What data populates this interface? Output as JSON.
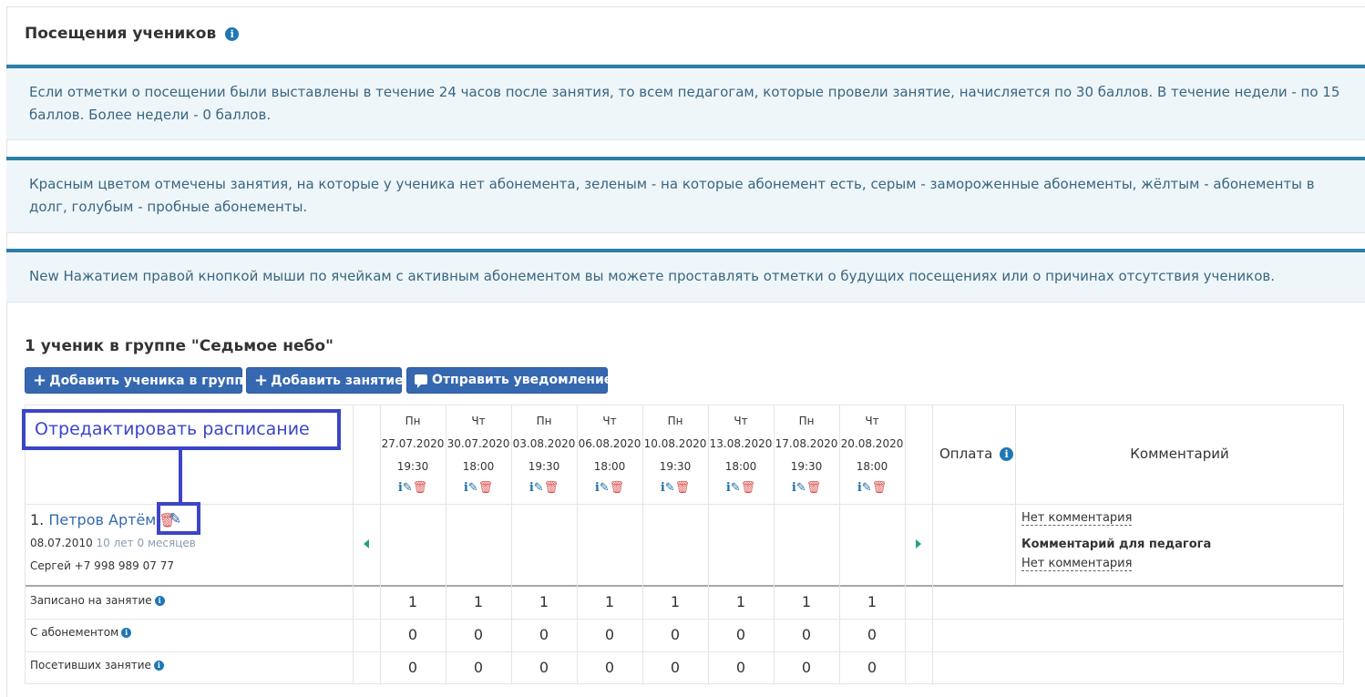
{
  "header": {
    "title": "Посещения учеников",
    "info_icon": "info-icon"
  },
  "alerts": [
    "Если отметки о посещении были выставлены в течение 24 часов после занятия, то всем педагогам, которые провели занятие, начисляется по 30 баллов. В течение недели - по 15 баллов. Более недели - 0 баллов.",
    "Красным цветом отмечены занятия, на которые у ученика нет абонемента, зеленым - на которые абонемент есть, серым - замороженные абонементы, жёлтым - абонементы в долг, голубым - пробные абонементы.",
    "New Нажатием правой кнопкой мыши по ячейкам с активным абонементом вы можете проставлять отметки о будущих посещениях или о причинах отсутствия учеников."
  ],
  "group": {
    "title": "1 ученик в группе \"Седьмое небо\"",
    "buttons": {
      "add_student": "Добавить ученика в группу",
      "add_lesson": "Добавить занятие",
      "send_notification": "Отправить уведомление"
    }
  },
  "annotation": {
    "text": "Отредактировать расписание",
    "color": "#3b45c8"
  },
  "lessons": [
    {
      "day": "Пн",
      "date": "27.07.2020",
      "time": "19:30"
    },
    {
      "day": "Чт",
      "date": "30.07.2020",
      "time": "18:00"
    },
    {
      "day": "Пн",
      "date": "03.08.2020",
      "time": "19:30"
    },
    {
      "day": "Чт",
      "date": "06.08.2020",
      "time": "18:00"
    },
    {
      "day": "Пн",
      "date": "10.08.2020",
      "time": "19:30"
    },
    {
      "day": "Чт",
      "date": "13.08.2020",
      "time": "18:00"
    },
    {
      "day": "Пн",
      "date": "17.08.2020",
      "time": "19:30"
    },
    {
      "day": "Чт",
      "date": "20.08.2020",
      "time": "18:00"
    }
  ],
  "columns": {
    "payment": "Оплата",
    "comment": "Комментарий"
  },
  "student": {
    "index": "1.",
    "name": "Петров Артём",
    "birth_date": "08.07.2010",
    "age": "10 лет 0 месяцев",
    "contact": "Сергей +7 998 989 07 77",
    "comment": "Нет комментария",
    "teacher_comment_label": "Комментарий для педагога",
    "teacher_comment": "Нет комментария"
  },
  "summary_rows": [
    {
      "label": "Записано на занятие",
      "values": [
        "1",
        "1",
        "1",
        "1",
        "1",
        "1",
        "1",
        "1"
      ]
    },
    {
      "label": "С абонементом",
      "values": [
        "0",
        "0",
        "0",
        "0",
        "0",
        "0",
        "0",
        "0"
      ]
    },
    {
      "label": "Посетивших занятие",
      "values": [
        "0",
        "0",
        "0",
        "0",
        "0",
        "0",
        "0",
        "0"
      ]
    }
  ],
  "colors": {
    "primary_button": "#3568b0",
    "alert_border": "#2a7fa6",
    "alert_bg": "#eef6fa",
    "trash": "#d9534f",
    "arrow": "#27a08a"
  }
}
